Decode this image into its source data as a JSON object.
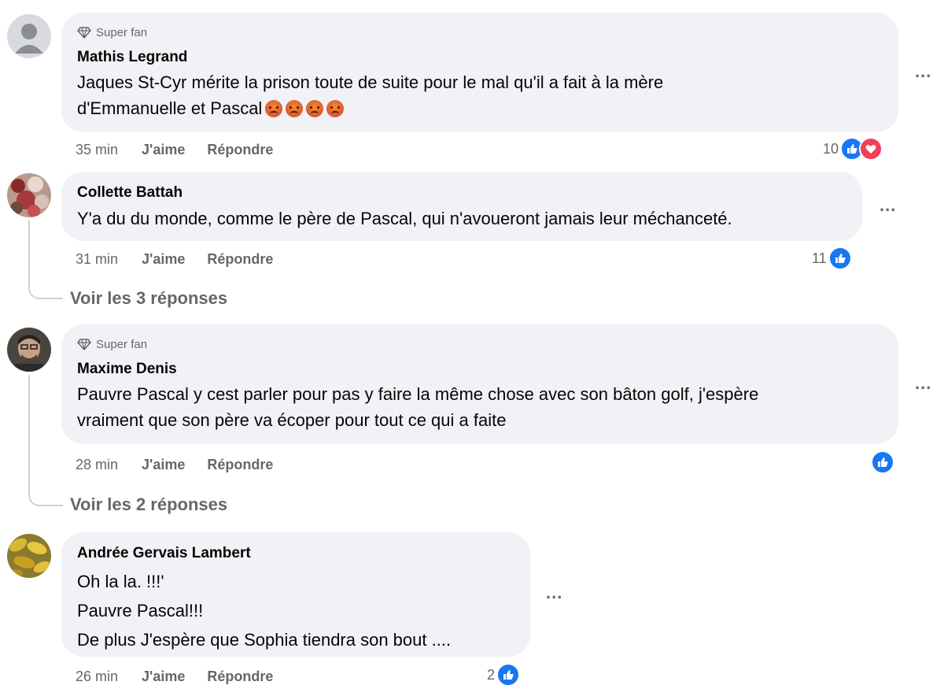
{
  "comments": [
    {
      "badge": "Super fan",
      "author": "Mathis Legrand",
      "text_lines": [
        "Jaques St-Cyr mérite la prison toute de suite pour le mal qu'il a fait à la mère",
        "d'Emmanuelle et Pascal"
      ],
      "emojis": [
        "angry-face",
        "angry-face",
        "angry-face",
        "angry-face"
      ],
      "time": "35 min",
      "like_label": "J'aime",
      "reply_label": "Répondre",
      "reaction_count": "10",
      "reactions": [
        "like",
        "love"
      ],
      "more_label": "..."
    },
    {
      "author": "Collette Battah",
      "text_lines": [
        "Y'a du du monde, comme le père de Pascal, qui n'avoueront jamais leur méchanceté."
      ],
      "time": "31 min",
      "like_label": "J'aime",
      "reply_label": "Répondre",
      "reaction_count": "11",
      "reactions": [
        "like"
      ],
      "more_label": "...",
      "view_replies": "Voir les 3 réponses"
    },
    {
      "badge": "Super fan",
      "author": "Maxime Denis",
      "text_lines": [
        "Pauvre Pascal y cest parler pour pas y faire la même chose avec son bâton golf, j'espère",
        "vraiment que son père va écoper pour tout ce qui a faite"
      ],
      "time": "28 min",
      "like_label": "J'aime",
      "reply_label": "Répondre",
      "reaction_count": "",
      "reactions": [
        "like"
      ],
      "more_label": "...",
      "view_replies": "Voir les 2 réponses"
    },
    {
      "author": "Andrée Gervais Lambert",
      "text_lines": [
        "Oh la la. !!!'",
        "Pauvre Pascal!!!",
        "De plus J'espère que Sophia tiendra son bout ...."
      ],
      "time": "26 min",
      "like_label": "J'aime",
      "reply_label": "Répondre",
      "reaction_count": "2",
      "reactions": [
        "like"
      ],
      "more_label": "..."
    }
  ],
  "colors": {
    "bubble": "#f0f2f5",
    "secondary_text": "#65676b",
    "like_blue": "#1877f2",
    "love_red": "#f33e58"
  }
}
